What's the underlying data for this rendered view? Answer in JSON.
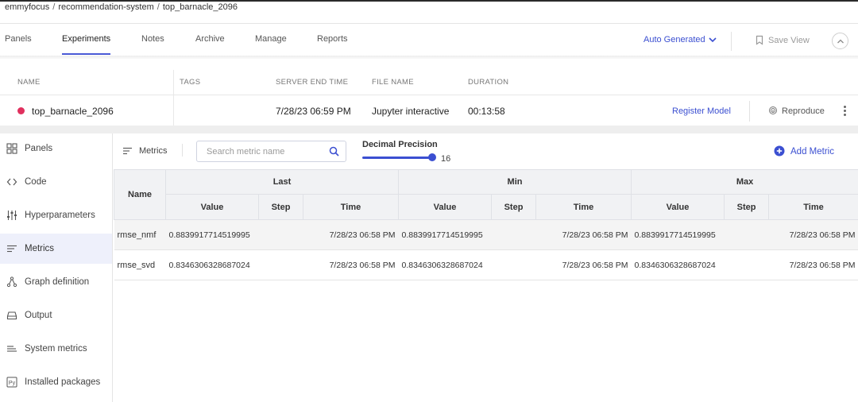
{
  "breadcrumb": [
    "emmyfocus",
    "recommendation-system",
    "top_barnacle_2096"
  ],
  "tabs": [
    {
      "label": "Panels",
      "active": false
    },
    {
      "label": "Experiments",
      "active": true
    },
    {
      "label": "Notes",
      "active": false
    },
    {
      "label": "Archive",
      "active": false
    },
    {
      "label": "Manage",
      "active": false
    },
    {
      "label": "Reports",
      "active": false
    }
  ],
  "view_selector": "Auto Generated",
  "save_view": "Save View",
  "experiment": {
    "headers": {
      "name": "NAME",
      "tags": "TAGS",
      "server_end_time": "SERVER END TIME",
      "file_name": "FILE NAME",
      "duration": "DURATION"
    },
    "name": "top_barnacle_2096",
    "status_color": "#e0305e",
    "server_end_time": "7/28/23 06:59 PM",
    "file_name": "Jupyter interactive",
    "duration": "00:13:58",
    "register_label": "Register Model",
    "reproduce_label": "Reproduce"
  },
  "sidebar": [
    {
      "label": "Panels",
      "icon": "panels-icon",
      "active": false
    },
    {
      "label": "Code",
      "icon": "code-icon",
      "active": false
    },
    {
      "label": "Hyperparameters",
      "icon": "sliders-icon",
      "active": false
    },
    {
      "label": "Metrics",
      "icon": "metrics-icon",
      "active": true
    },
    {
      "label": "Graph definition",
      "icon": "graph-icon",
      "active": false
    },
    {
      "label": "Output",
      "icon": "output-icon",
      "active": false
    },
    {
      "label": "System metrics",
      "icon": "system-metrics-icon",
      "active": false
    },
    {
      "label": "Installed packages",
      "icon": "python-icon",
      "active": false
    }
  ],
  "metrics_panel": {
    "title": "Metrics",
    "search_placeholder": "Search metric name",
    "precision_label": "Decimal Precision",
    "precision_value": "16",
    "add_metric": "Add Metric"
  },
  "table": {
    "name_header": "Name",
    "groups": [
      "Last",
      "Min",
      "Max"
    ],
    "sub_headers": [
      "Value",
      "Step",
      "Time"
    ],
    "rows": [
      {
        "name": "rmse_nmf",
        "last": {
          "value": "0.8839917714519995",
          "step": "",
          "time": "7/28/23 06:58 PM"
        },
        "min": {
          "value": "0.8839917714519995",
          "step": "",
          "time": "7/28/23 06:58 PM"
        },
        "max": {
          "value": "0.8839917714519995",
          "step": "",
          "time": "7/28/23 06:58 PM"
        }
      },
      {
        "name": "rmse_svd",
        "last": {
          "value": "0.8346306328687024",
          "step": "",
          "time": "7/28/23 06:58 PM"
        },
        "min": {
          "value": "0.8346306328687024",
          "step": "",
          "time": "7/28/23 06:58 PM"
        },
        "max": {
          "value": "0.8346306328687024",
          "step": "",
          "time": "7/28/23 06:58 PM"
        }
      }
    ]
  }
}
